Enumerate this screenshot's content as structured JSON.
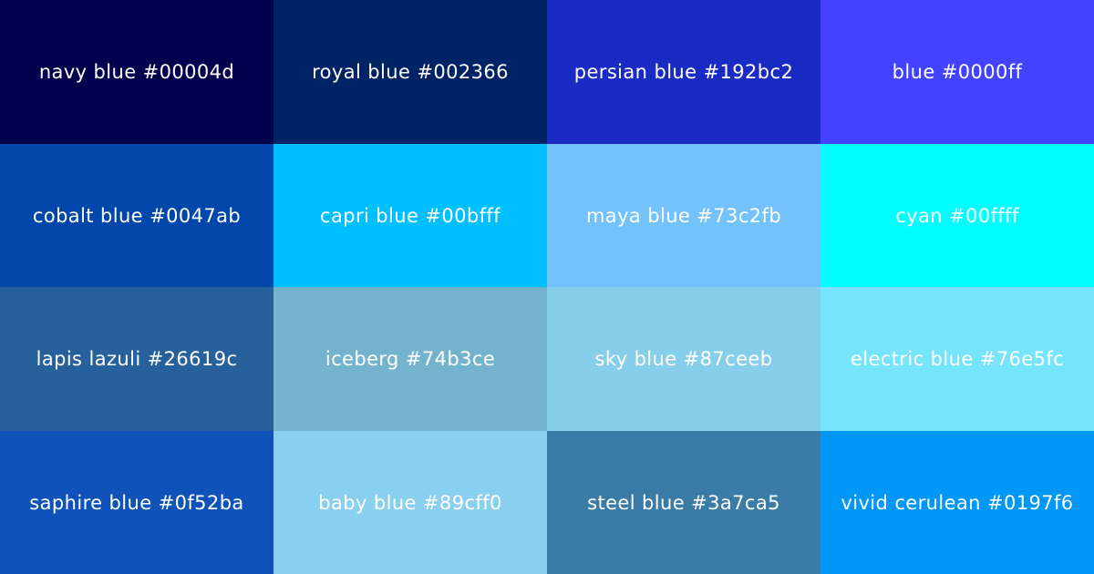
{
  "swatches": [
    {
      "label": "navy blue #00004d",
      "color": "#00004d"
    },
    {
      "label": "royal blue #002366",
      "color": "#002366"
    },
    {
      "label": "persian blue #192bc2",
      "color": "#192bc2"
    },
    {
      "label": "blue #0000ff",
      "color": "#4343ff"
    },
    {
      "label": "cobalt blue #0047ab",
      "color": "#0047ab"
    },
    {
      "label": "capri blue #00bfff",
      "color": "#00bfff"
    },
    {
      "label": "maya blue #73c2fb",
      "color": "#73c2fb"
    },
    {
      "label": "cyan #00ffff",
      "color": "#00ffff"
    },
    {
      "label": "lapis lazuli #26619c",
      "color": "#26619c"
    },
    {
      "label": "iceberg #74b3ce",
      "color": "#74b3ce"
    },
    {
      "label": "sky blue #87ceeb",
      "color": "#87ceeb"
    },
    {
      "label": "electric blue #76e5fc",
      "color": "#76e5fc"
    },
    {
      "label": "saphire blue #0f52ba",
      "color": "#0f52ba"
    },
    {
      "label": "baby blue #89cff0",
      "color": "#89cff0"
    },
    {
      "label": "steel blue #3a7ca5",
      "color": "#3a7ca5"
    },
    {
      "label": "vivid cerulean #0197f6",
      "color": "#0197f6"
    }
  ]
}
